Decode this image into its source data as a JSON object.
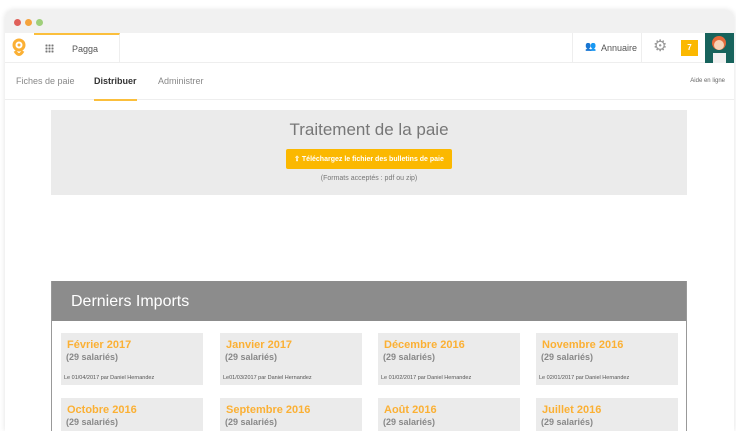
{
  "window": {
    "dots": [
      "#e0605a",
      "#f5a33c",
      "#9fcf7a"
    ]
  },
  "header": {
    "app_name": "Pagga",
    "directory_label": "Annuaire",
    "notification_count": "7"
  },
  "tabs": [
    {
      "label": "Fiches de paie"
    },
    {
      "label": "Distribuer",
      "active": true
    },
    {
      "label": "Administrer"
    }
  ],
  "help_label": "Aide en ligne",
  "upload": {
    "title": "Traitement de la paie",
    "button_label": "Téléchargez le fichier des bulletins de paie",
    "formats": "(Formats acceptés : pdf ou zip)"
  },
  "imports": {
    "title": "Derniers Imports",
    "cards": [
      {
        "title": "Février 2017",
        "count": "(29 salariés)",
        "meta": "Le 01/04/2017 par Daniel Hernandez"
      },
      {
        "title": "Janvier 2017",
        "count": "(29 salariés)",
        "meta": "Le01/03/2017 par Daniel Hernandez"
      },
      {
        "title": "Décembre 2016",
        "count": "(29 salariés)",
        "meta": "Le 01/02/2017 par Daniel Hernandez"
      },
      {
        "title": "Novembre 2016",
        "count": "(29 salariés)",
        "meta": "Le 02/01/2017 par Daniel Hernandez"
      },
      {
        "title": "Octobre 2016",
        "count": "(29 salariés)"
      },
      {
        "title": "Septembre 2016",
        "count": "(29 salariés)"
      },
      {
        "title": "Août 2016",
        "count": "(29 salariés)"
      },
      {
        "title": "Juillet 2016",
        "count": "(29 salariés)"
      }
    ]
  }
}
